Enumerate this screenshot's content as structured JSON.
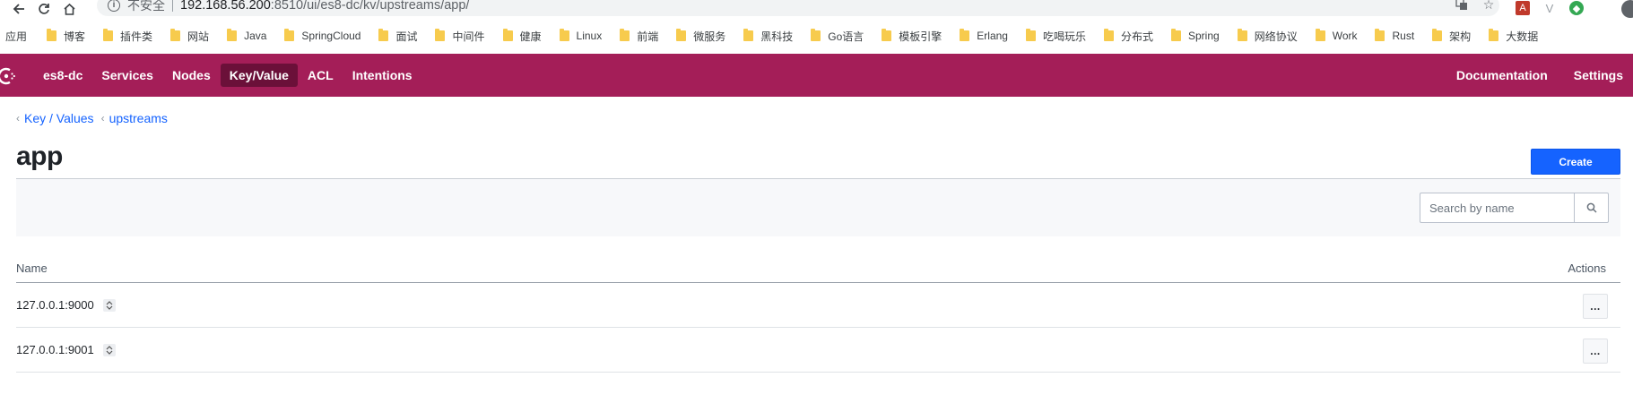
{
  "browser": {
    "insecure_label": "不安全",
    "url_host": "192.168.56.200",
    "url_rest": ":8510/ui/es8-dc/kv/upstreams/app/",
    "bookmarks": [
      "应用",
      "博客",
      "插件类",
      "网站",
      "Java",
      "SpringCloud",
      "面试",
      "中间件",
      "健康",
      "Linux",
      "前端",
      "微服务",
      "黑科技",
      "Go语言",
      "模板引擎",
      "Erlang",
      "吃喝玩乐",
      "分布式",
      "Spring",
      "网络协议",
      "Work",
      "Rust",
      "架构",
      "大数据"
    ]
  },
  "nav": {
    "datacenter": "es8-dc",
    "items": [
      "Services",
      "Nodes",
      "Key/Value",
      "ACL",
      "Intentions"
    ],
    "active": "Key/Value",
    "right": [
      "Documentation",
      "Settings"
    ],
    "brand_color": "#a41e58"
  },
  "breadcrumb": [
    "Key / Values",
    "upstreams"
  ],
  "page": {
    "title": "app",
    "create_label": "Create"
  },
  "search": {
    "placeholder": "Search by name"
  },
  "table": {
    "columns": {
      "name": "Name",
      "actions": "Actions"
    },
    "rows": [
      {
        "name": "127.0.0.1:9000"
      },
      {
        "name": "127.0.0.1:9001"
      }
    ],
    "row_action_label": "..."
  }
}
